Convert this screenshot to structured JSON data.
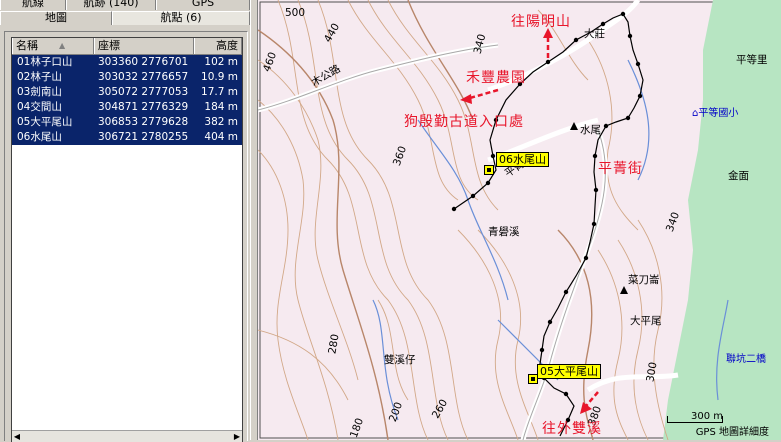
{
  "tabs_top": [
    "航線",
    "航跡 (140)",
    "GPS"
  ],
  "tabs_second": [
    "地圖",
    "航點 (6)"
  ],
  "list": {
    "headers": {
      "name": "名稱",
      "coord": "座標",
      "elev": "高度"
    },
    "sort_indicator": "▲",
    "rows": [
      {
        "name": "01林子口山",
        "coord": "303360 2776701",
        "elev": "102 m"
      },
      {
        "name": "02林子山",
        "coord": "303032 2776657",
        "elev": "10.9 m"
      },
      {
        "name": "03劍南山",
        "coord": "305072 2777053",
        "elev": "17.7 m"
      },
      {
        "name": "04交間山",
        "coord": "304871 2776329",
        "elev": "184 m"
      },
      {
        "name": "05大平尾山",
        "coord": "306853 2779628",
        "elev": "382 m"
      },
      {
        "name": "06水尾山",
        "coord": "306721 2780255",
        "elev": "404 m"
      }
    ]
  },
  "map": {
    "labels": {
      "elev500": "500",
      "c440": "440",
      "c460": "460",
      "c340a": "340",
      "c360": "360",
      "c340b": "340",
      "c380": "380",
      "c300": "300",
      "c280": "280",
      "c200": "200",
      "c260": "260",
      "c180": "180",
      "road_mugong": "木公路",
      "road_pingqing": "平菁街",
      "place_dazhuang": "大莊",
      "place_shuiwei": "水尾",
      "place_qingshanxi": "青礐溪",
      "place_jinmian": "金面",
      "place_caidaolun": "菜刀崙",
      "place_dapingwei": "大平尾",
      "place_shuangxizai": "雙溪仔",
      "place_pingdeng": "平等里",
      "blue_school": "平等國小",
      "blue_bridge": "聯坑二橋"
    },
    "annotations": {
      "to_yangming": "往陽明山",
      "hefeng": "禾豐農園",
      "goujin": "狗殷勤古道入口處",
      "pingqing": "平菁街",
      "to_shuangxi": "往外雙溪"
    },
    "waypoints": {
      "wp06": "06水尾山",
      "wp05": "05大平尾山"
    },
    "scale_text": "300 m",
    "footer_text": "GPS 地圖詳細度"
  }
}
